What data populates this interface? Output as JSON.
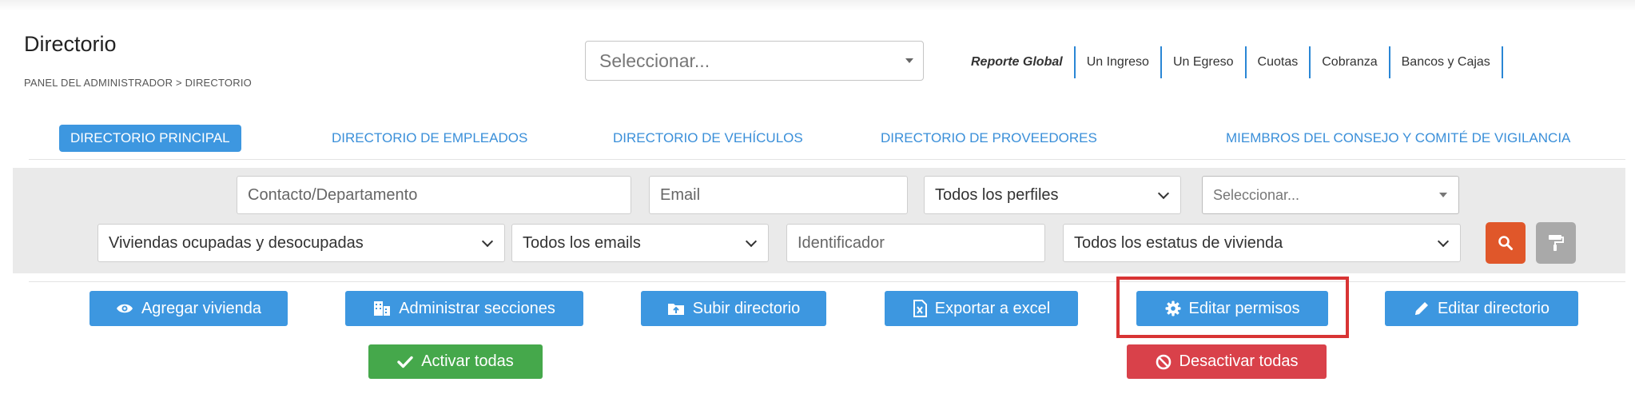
{
  "header": {
    "title": "Directorio",
    "breadcrumb": "PANEL DEL ADMINISTRADOR > DIRECTORIO",
    "top_select_placeholder": "Seleccionar..."
  },
  "report_links": [
    "Reporte Global",
    "Un Ingreso",
    "Un Egreso",
    "Cuotas",
    "Cobranza",
    "Bancos y Cajas"
  ],
  "tabs": [
    {
      "label": "DIRECTORIO PRINCIPAL",
      "active": true
    },
    {
      "label": "DIRECTORIO DE EMPLEADOS"
    },
    {
      "label": "DIRECTORIO DE VEHÍCULOS"
    },
    {
      "label": "DIRECTORIO DE PROVEEDORES"
    },
    {
      "label": "MIEMBROS DEL CONSEJO Y COMITÉ DE VIGILANCIA"
    }
  ],
  "filters": {
    "contacto_placeholder": "Contacto/Departamento",
    "email_placeholder": "Email",
    "perfiles_value": "Todos los perfiles",
    "seleccionar_placeholder": "Seleccionar...",
    "viviendas_value": "Viviendas ocupadas y desocupadas",
    "emails_value": "Todos los emails",
    "identificador_placeholder": "Identificador",
    "estatus_value": "Todos los estatus de vivienda"
  },
  "actions": {
    "agregar": "Agregar vivienda",
    "administrar": "Administrar secciones",
    "subir": "Subir directorio",
    "exportar": "Exportar a excel",
    "permisos": "Editar permisos",
    "editar": "Editar directorio",
    "activar": "Activar todas",
    "desactivar": "Desactivar todas"
  },
  "colors": {
    "primary": "#3d97e0",
    "success": "#45a84b",
    "danger": "#d9414a",
    "search": "#e0572a",
    "highlight": "#d83434"
  }
}
